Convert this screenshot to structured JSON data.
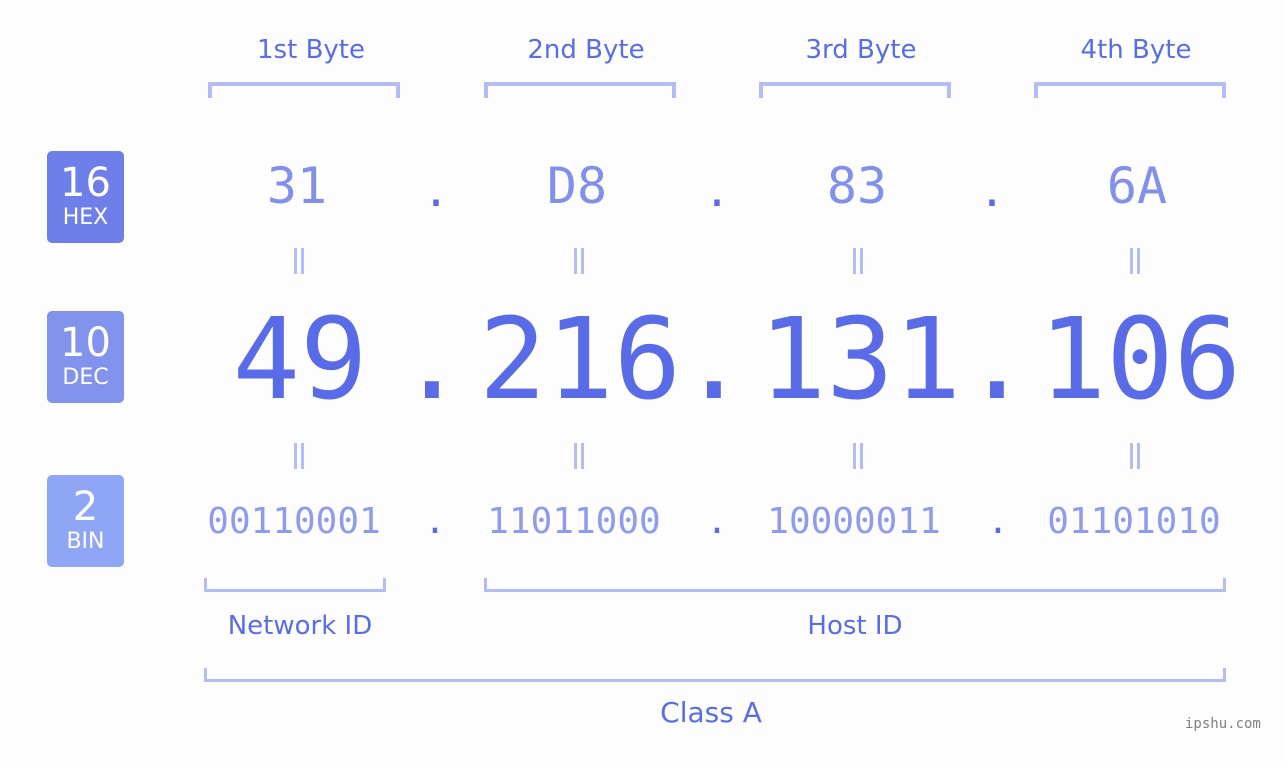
{
  "badges": [
    {
      "base": "16",
      "label": "HEX",
      "color": "#6f7fe9"
    },
    {
      "base": "10",
      "label": "DEC",
      "color": "#8293ee"
    },
    {
      "base": "2",
      "label": "BIN",
      "color": "#8fa6f6"
    }
  ],
  "bytes": [
    {
      "title": "1st Byte",
      "hex": "31",
      "dec": "49",
      "bin": "00110001"
    },
    {
      "title": "2nd Byte",
      "hex": "D8",
      "dec": "216",
      "bin": "11011000"
    },
    {
      "title": "3rd Byte",
      "hex": "83",
      "dec": "131",
      "bin": "10000011"
    },
    {
      "title": "4th Byte",
      "hex": "6A",
      "dec": "106",
      "bin": "01101010"
    }
  ],
  "separator": ".",
  "network_id_label": "Network ID",
  "host_id_label": "Host ID",
  "class_label": "Class A",
  "footer": "ipshu.com",
  "colors": {
    "accent": "#5a6be8",
    "bracket": "#b3bcf5",
    "background": "#fcfdfc"
  }
}
